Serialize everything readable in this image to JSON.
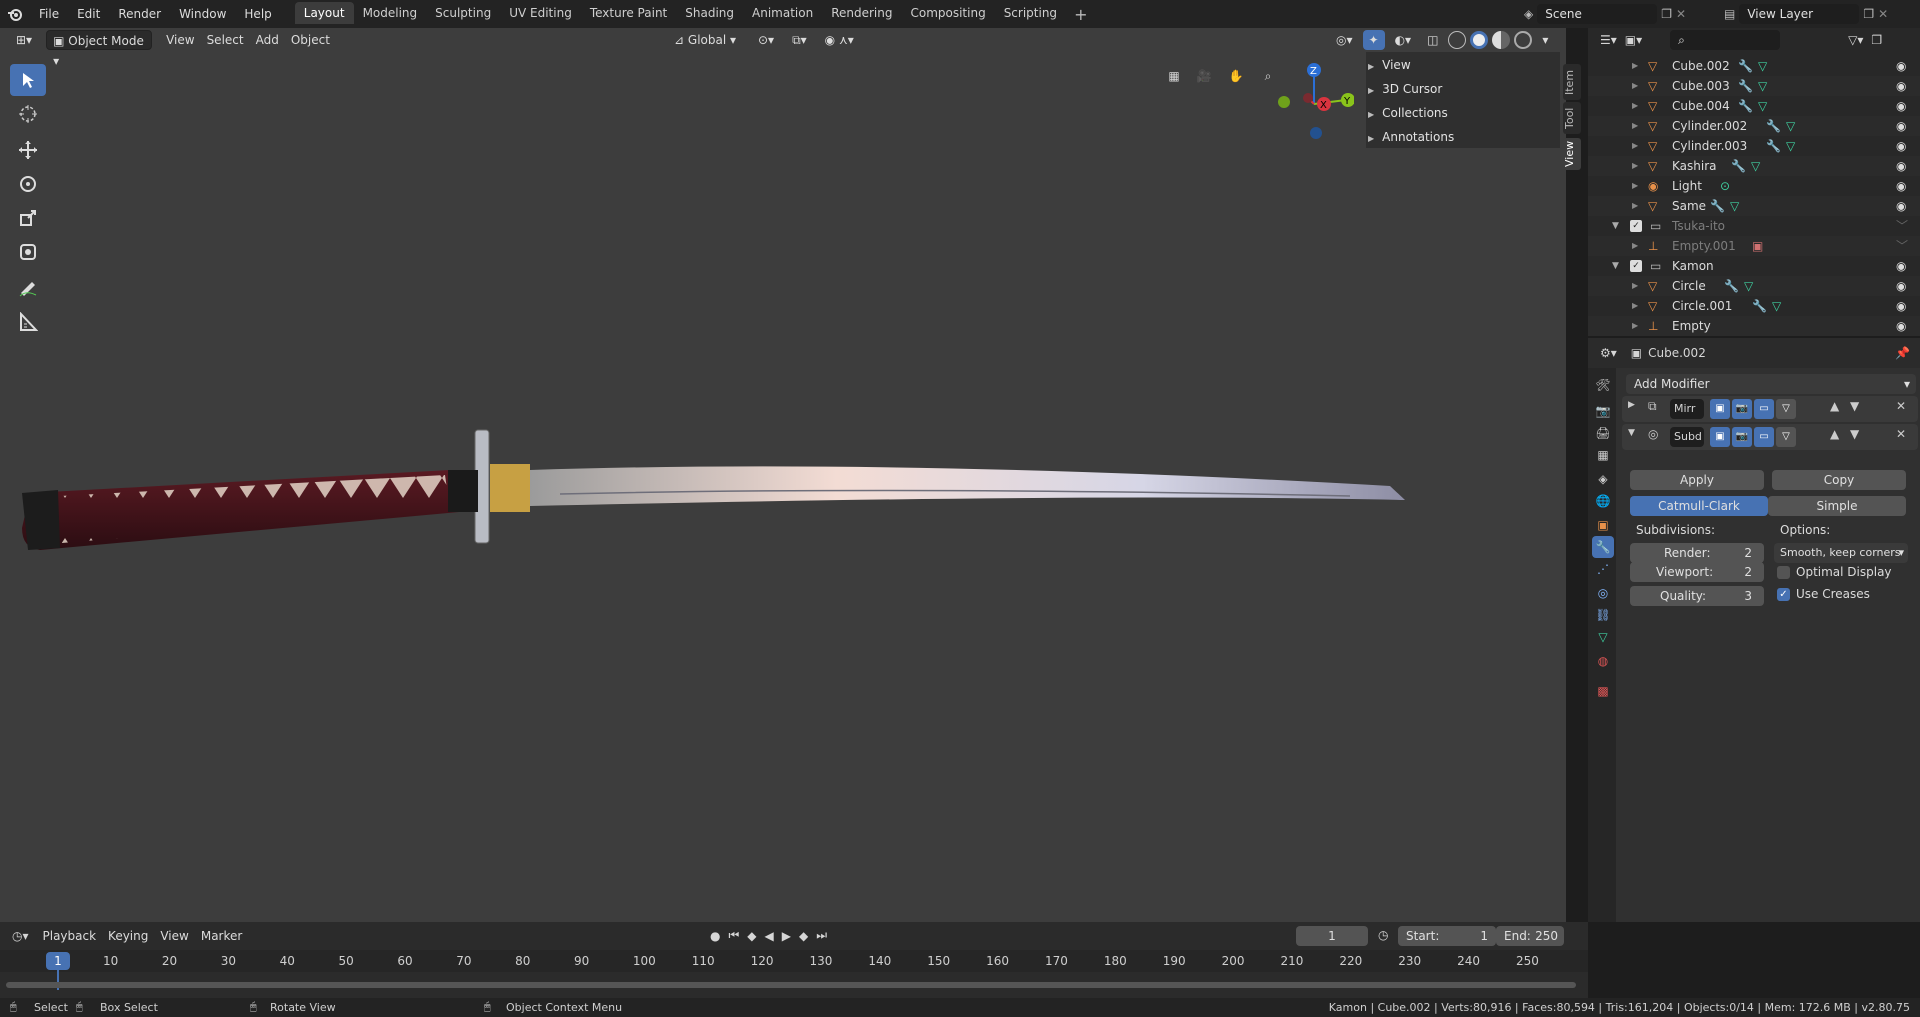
{
  "topbar": {
    "menus": [
      "File",
      "Edit",
      "Render",
      "Window",
      "Help"
    ],
    "workspaces": [
      "Layout",
      "Modeling",
      "Sculpting",
      "UV Editing",
      "Texture Paint",
      "Shading",
      "Animation",
      "Rendering",
      "Compositing",
      "Scripting"
    ],
    "active_workspace": "Layout",
    "add_tab": "+",
    "scene": "Scene",
    "view_layer": "View Layer"
  },
  "viewport": {
    "mode": "Object Mode",
    "menus": [
      "View",
      "Select",
      "Add",
      "Object"
    ],
    "orientation": "Global",
    "npanel": [
      "View",
      "3D Cursor",
      "Collections",
      "Annotations"
    ],
    "side_tabs": [
      "Item",
      "Tool",
      "View"
    ],
    "gizmo": {
      "z": "Z",
      "x": "X",
      "y": "Y"
    }
  },
  "outliner": {
    "rows": [
      {
        "name": "Cube.002",
        "type": "mesh",
        "dim": false
      },
      {
        "name": "Cube.003",
        "type": "mesh",
        "dim": false
      },
      {
        "name": "Cube.004",
        "type": "mesh",
        "dim": false
      },
      {
        "name": "Cylinder.002",
        "type": "mesh",
        "dim": false
      },
      {
        "name": "Cylinder.003",
        "type": "mesh",
        "dim": false
      },
      {
        "name": "Kashira",
        "type": "mesh",
        "dim": false
      },
      {
        "name": "Light",
        "type": "light",
        "dim": false
      },
      {
        "name": "Same",
        "type": "mesh",
        "dim": false
      },
      {
        "name": "Tsuka-ito",
        "type": "collection",
        "dim": true
      },
      {
        "name": "Empty.001",
        "type": "empty",
        "dim": true
      },
      {
        "name": "Kamon",
        "type": "collection",
        "dim": false
      },
      {
        "name": "Circle",
        "type": "mesh",
        "dim": false
      },
      {
        "name": "Circle.001",
        "type": "mesh",
        "dim": false
      },
      {
        "name": "Empty",
        "type": "empty",
        "dim": false
      }
    ]
  },
  "properties": {
    "object": "Cube.002",
    "add_modifier": "Add Modifier",
    "modifiers": [
      {
        "name": "Mirr",
        "expanded": false
      },
      {
        "name": "Subd",
        "expanded": true
      }
    ],
    "apply": "Apply",
    "copy": "Copy",
    "catmull": "Catmull-Clark",
    "simple": "Simple",
    "subdivisions_label": "Subdivisions:",
    "options_label": "Options:",
    "render_label": "Render:",
    "render_value": "2",
    "viewport_label": "Viewport:",
    "viewport_value": "2",
    "quality_label": "Quality:",
    "quality_value": "3",
    "uv_smooth": "Smooth, keep corners",
    "optimal_display": "Optimal Display",
    "use_creases": "Use Creases"
  },
  "timeline": {
    "menus": [
      "Playback",
      "Keying",
      "View",
      "Marker"
    ],
    "current_frame": "1",
    "start_label": "Start:",
    "start": "1",
    "end_label": "End:",
    "end": "250",
    "ticks": [
      "1",
      "10",
      "20",
      "30",
      "40",
      "50",
      "60",
      "70",
      "80",
      "90",
      "100",
      "110",
      "120",
      "130",
      "140",
      "150",
      "160",
      "170",
      "180",
      "190",
      "200",
      "210",
      "220",
      "230",
      "240",
      "250"
    ]
  },
  "statusbar": {
    "select": "Select",
    "box_select": "Box Select",
    "rotate": "Rotate View",
    "context": "Object Context Menu",
    "stats": "Kamon | Cube.002 | Verts:80,916 | Faces:80,594 | Tris:161,204 | Objects:0/14 | Mem: 172.6 MB | v2.80.75"
  },
  "colors": {
    "accent": "#4772b3",
    "mesh_icon": "#e8914a",
    "wrench": "#84b8ff",
    "vert_data": "#3fd0a0"
  }
}
